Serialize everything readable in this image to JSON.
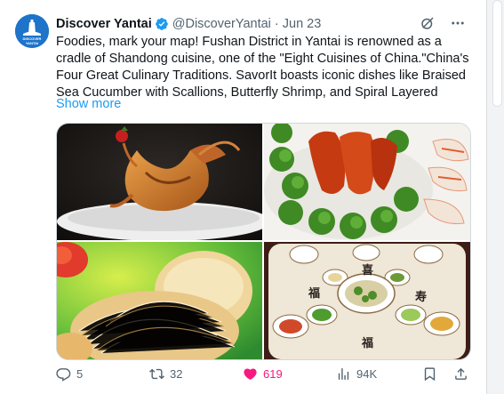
{
  "tweet": {
    "display_name": "Discover Yantai",
    "handle": "@DiscoverYantai",
    "separator": "·",
    "time": "Jun 23",
    "avatar_text": "DISCOVER YANTAI",
    "text": "Foodies, mark your map! Fushan District in Yantai is renowned as a cradle of Shandong cuisine, one of the \"Eight Cuisines of China.\"China's Four Great Culinary Traditions. SavorIt boasts iconic dishes like Braised Sea Cucumber with Scallions, Butterfly Shrimp, and Spiral Layered",
    "show_more": "Show more",
    "media": [
      {
        "name": "butterfly-shrimp-photo"
      },
      {
        "name": "shrimp-broccoli-platter-photo"
      },
      {
        "name": "spiral-pastry-photo"
      },
      {
        "name": "fu-banquet-table-photo"
      }
    ],
    "table_characters": [
      "福",
      "寿",
      "福",
      "喜"
    ],
    "actions": {
      "replies": "5",
      "reposts": "32",
      "likes": "619",
      "views": "94K"
    }
  },
  "colors": {
    "accent": "#1d9bf0",
    "like": "#f91880",
    "muted": "#536471",
    "verified": "#1d9bf0"
  }
}
